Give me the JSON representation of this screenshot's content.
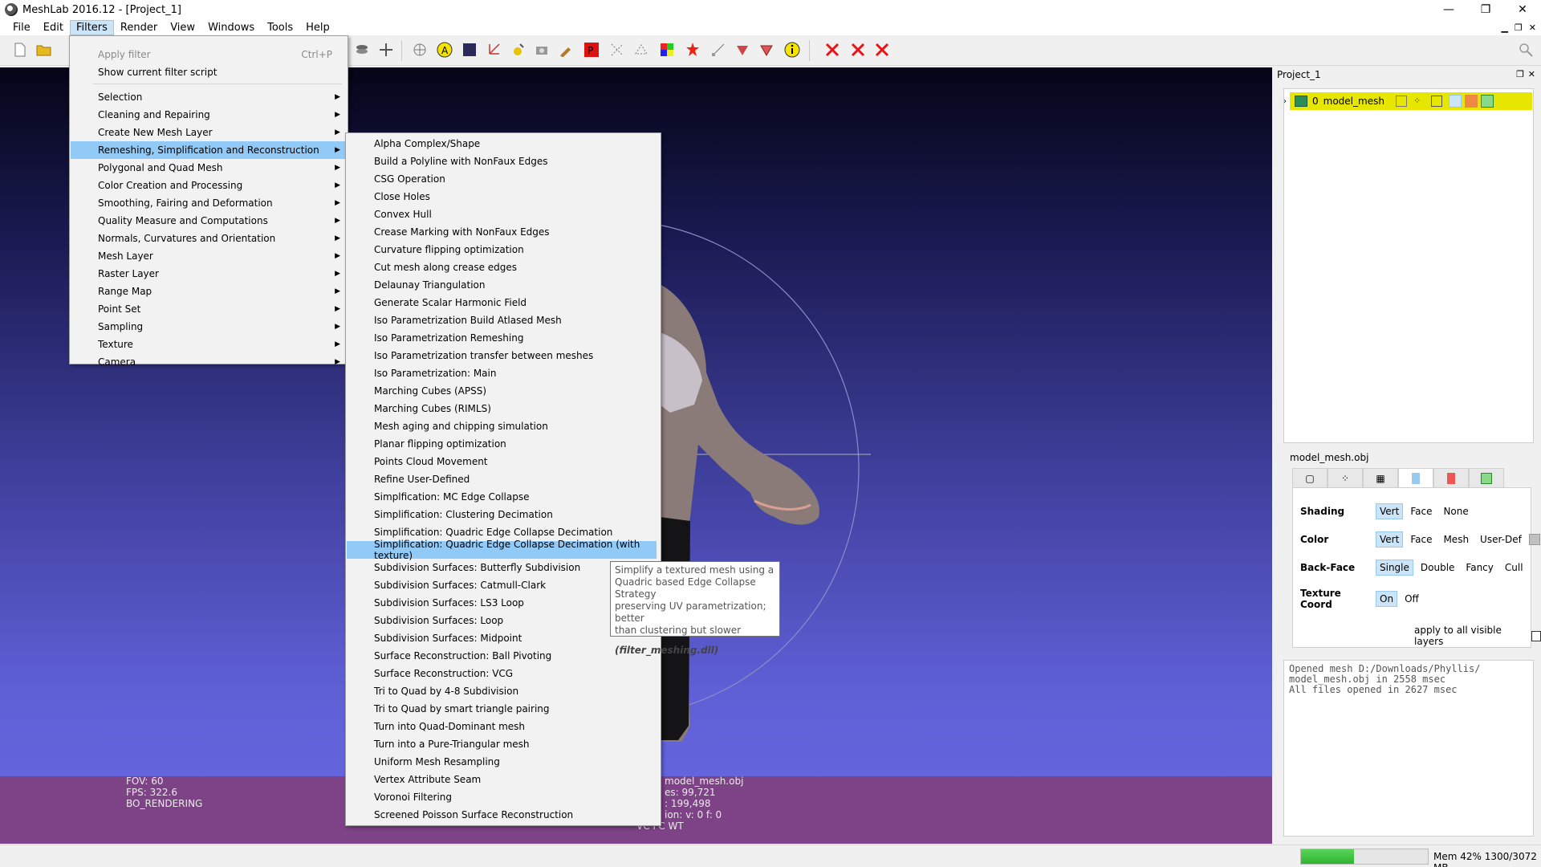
{
  "window": {
    "title": "MeshLab 2016.12 - [Project_1]",
    "minimize": "—",
    "maximize": "❐",
    "close": "✕"
  },
  "menubar": {
    "items": [
      "File",
      "Edit",
      "Filters",
      "Render",
      "View",
      "Windows",
      "Tools",
      "Help"
    ],
    "active": "Filters"
  },
  "filters_menu": {
    "items": [
      {
        "label": "Apply filter",
        "shortcut": "Ctrl+P",
        "disabled": true
      },
      {
        "label": "Show current filter script"
      },
      {
        "label": "Selection"
      },
      {
        "label": "Cleaning and Repairing"
      },
      {
        "label": "Create New Mesh Layer"
      },
      {
        "label": "Remeshing, Simplification and Reconstruction"
      },
      {
        "label": "Polygonal and Quad Mesh"
      },
      {
        "label": "Color Creation and Processing"
      },
      {
        "label": "Smoothing, Fairing and Deformation"
      },
      {
        "label": "Quality Measure and Computations"
      },
      {
        "label": "Normals, Curvatures and Orientation"
      },
      {
        "label": "Mesh Layer"
      },
      {
        "label": "Raster Layer"
      },
      {
        "label": "Range Map"
      },
      {
        "label": "Point Set"
      },
      {
        "label": "Sampling"
      },
      {
        "label": "Texture"
      },
      {
        "label": "Camera"
      }
    ]
  },
  "remesh_submenu": {
    "items": [
      "Alpha Complex/Shape",
      "Build a Polyline with NonFaux Edges",
      "CSG Operation",
      "Close Holes",
      "Convex Hull",
      "Crease Marking with NonFaux Edges",
      "Curvature flipping optimization",
      "Cut mesh along crease edges",
      "Delaunay Triangulation",
      "Generate Scalar Harmonic Field",
      "Iso Parametrization Build Atlased Mesh",
      "Iso Parametrization Remeshing",
      "Iso Parametrization transfer between meshes",
      "Iso Parametrization: Main",
      "Marching Cubes (APSS)",
      "Marching Cubes (RIMLS)",
      "Mesh aging and chipping simulation",
      "Planar flipping optimization",
      "Points Cloud Movement",
      "Refine User-Defined",
      "Simplfication: MC Edge Collapse",
      "Simplification: Clustering Decimation",
      "Simplification: Quadric Edge Collapse Decimation",
      "Simplification: Quadric Edge Collapse Decimation (with texture)",
      "Subdivision Surfaces: Butterfly Subdivision",
      "Subdivision Surfaces: Catmull-Clark",
      "Subdivision Surfaces: LS3 Loop",
      "Subdivision Surfaces: Loop",
      "Subdivision Surfaces: Midpoint",
      "Surface Reconstruction: Ball Pivoting",
      "Surface Reconstruction: VCG",
      "Tri to Quad by 4-8 Subdivision",
      "Tri to Quad by smart triangle pairing",
      "Turn into Quad-Dominant mesh",
      "Turn into a Pure-Triangular mesh",
      "Uniform Mesh Resampling",
      "Vertex Attribute Seam",
      "Voronoi Filtering",
      "Screened Poisson Surface Reconstruction"
    ],
    "highlighted_index": 23
  },
  "tooltip": {
    "lines": [
      "Simplify a textured mesh using a",
      "Quadric based Edge Collapse Strategy",
      "preserving UV parametrization; better",
      "than clustering but slower"
    ],
    "source": "(filter_meshing.dll)"
  },
  "viewport_info": {
    "fov": "FOV: 60",
    "fps": "FPS:   322.6",
    "rendering": "BO_RENDERING",
    "mesh_name": "model_mesh.obj",
    "vertices": "es: 99,721",
    "faces": ": 199,498",
    "selection": "ion: v: 0 f: 0",
    "vc": "VC FC WT"
  },
  "project_panel": {
    "title": "Project_1",
    "layer": {
      "index": "0",
      "name": "model_mesh"
    },
    "mesh_file": "model_mesh.obj"
  },
  "render_props": {
    "shading": {
      "label": "Shading",
      "options": [
        "Vert",
        "Face",
        "None"
      ],
      "active": "Vert"
    },
    "color": {
      "label": "Color",
      "options": [
        "Vert",
        "Face",
        "Mesh",
        "User-Def"
      ],
      "active": "Vert"
    },
    "backface": {
      "label": "Back-Face",
      "options": [
        "Single",
        "Double",
        "Fancy",
        "Cull"
      ],
      "active": "Single"
    },
    "texcoord": {
      "label": "Texture Coord",
      "options": [
        "On",
        "Off"
      ],
      "active": "On"
    },
    "apply_all": "apply to all visible layers"
  },
  "log": {
    "text": "Opened mesh D:/Downloads/Phyllis/\nmodel_mesh.obj in 2558 msec\nAll files opened in 2627 msec"
  },
  "status": {
    "mem_text": "Mem 42% 1300/3072 MB",
    "mem_fraction": 0.42
  }
}
